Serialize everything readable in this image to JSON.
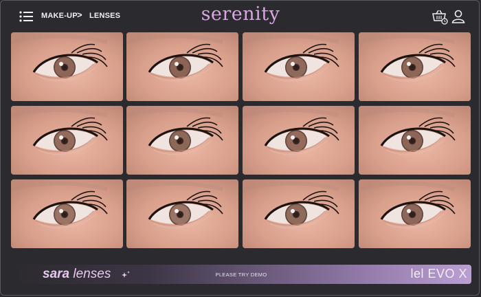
{
  "header": {
    "breadcrumb": [
      "MAKE-UP",
      "LENSES"
    ],
    "separator": ">",
    "brand": "serenity",
    "brand_color": "#d9a6e3"
  },
  "icons": {
    "menu": "hamburger-menu-icon",
    "cart": "basket-clock-icon",
    "user": "user-icon",
    "sparkle": "sparkle-icon"
  },
  "gallery": {
    "rows": 3,
    "columns": 4,
    "items": [
      {
        "iris": "#8d6657"
      },
      {
        "iris": "#8b6456"
      },
      {
        "iris": "#8f6a5c"
      },
      {
        "iris": "#8e6758"
      },
      {
        "iris": "#946c5d"
      },
      {
        "iris": "#8c6858"
      },
      {
        "iris": "#956b5c"
      },
      {
        "iris": "#8c6656"
      },
      {
        "iris": "#9b7364"
      },
      {
        "iris": "#9a7465"
      },
      {
        "iris": "#8f6b5c"
      },
      {
        "iris": "#8d6758"
      }
    ]
  },
  "footer": {
    "brand_main": "sara",
    "brand_sub": "lenses",
    "cta": "PLEASE TRY DEMO",
    "partner_logo": "lel EVO X"
  }
}
